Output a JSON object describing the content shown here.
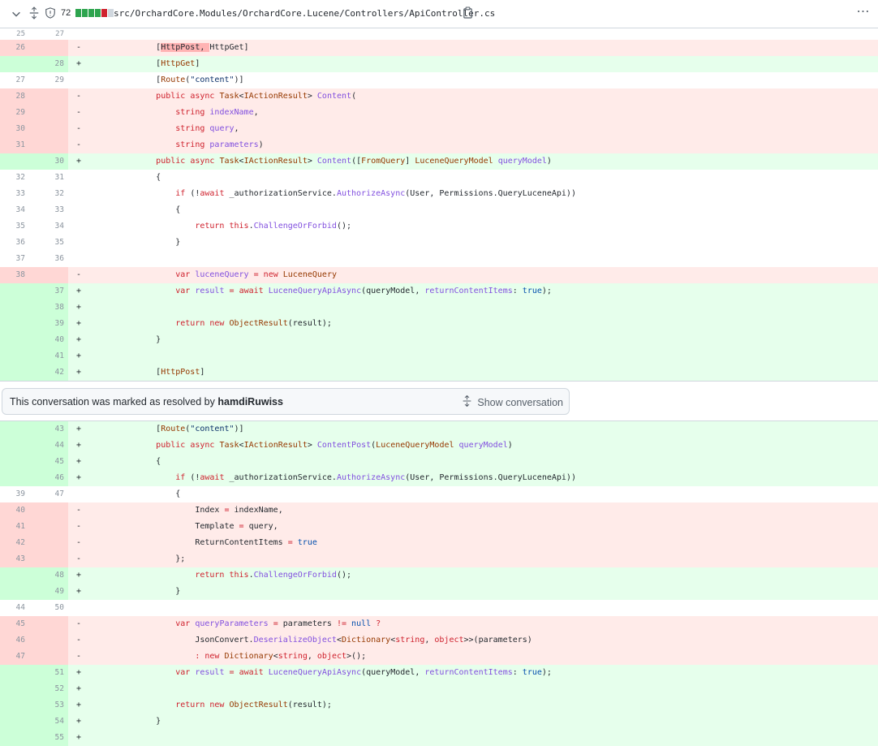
{
  "file": {
    "changed_count": "72",
    "path": "src/OrchardCore.Modules/OrchardCore.Lucene/Controllers/ApiController.cs",
    "diffstat_colors": [
      "#2da44e",
      "#2da44e",
      "#2da44e",
      "#2da44e",
      "#cf222e",
      "#d0d7de"
    ],
    "more_icon": "kebab-horizontal-icon"
  },
  "conversation": {
    "text": "This conversation was marked as resolved by ",
    "user": "hamdiRuwiss",
    "show_label": "Show conversation"
  },
  "hunk_top": {
    "left": "25",
    "right": "27"
  },
  "rows_a": [
    {
      "t": "del",
      "l": "26",
      "r": "",
      "s": "-",
      "html": "        [<span class=\"hl\">HttpPost, </span>HttpGet]"
    },
    {
      "t": "add",
      "l": "",
      "r": "28",
      "s": "+",
      "html": "        [<span class=\"ty\">HttpGet</span>]"
    },
    {
      "t": "ctx",
      "l": "27",
      "r": "29",
      "s": "",
      "html": "        [<span class=\"ty\">Route</span>(<span class=\"st\">\"content\"</span>)]"
    },
    {
      "t": "del",
      "l": "28",
      "r": "",
      "s": "-",
      "html": "        <span class=\"kw\">public async</span> <span class=\"ty\">Task</span>&lt;<span class=\"ty\">IActionResult</span>&gt; <span class=\"fn\">Content</span>("
    },
    {
      "t": "del",
      "l": "29",
      "r": "",
      "s": "-",
      "html": "            <span class=\"kw\">string</span> <span class=\"fn\">indexName</span>,"
    },
    {
      "t": "del",
      "l": "30",
      "r": "",
      "s": "-",
      "html": "            <span class=\"kw\">string</span> <span class=\"fn\">query</span>,"
    },
    {
      "t": "del",
      "l": "31",
      "r": "",
      "s": "-",
      "html": "            <span class=\"kw\">string</span> <span class=\"fn\">parameters</span>)"
    },
    {
      "t": "add",
      "l": "",
      "r": "30",
      "s": "+",
      "html": "        <span class=\"kw\">public async</span> <span class=\"ty\">Task</span>&lt;<span class=\"ty\">IActionResult</span>&gt; <span class=\"fn\">Content</span>([<span class=\"ty\">FromQuery</span>] <span class=\"ty\">LuceneQueryModel</span> <span class=\"fn\">queryModel</span>)"
    },
    {
      "t": "ctx",
      "l": "32",
      "r": "31",
      "s": "",
      "html": "        {"
    },
    {
      "t": "ctx",
      "l": "33",
      "r": "32",
      "s": "",
      "html": "            <span class=\"kw\">if</span> (!<span class=\"kw\">await</span> _authorizationService.<span class=\"fn\">AuthorizeAsync</span>(User, Permissions.QueryLuceneApi))"
    },
    {
      "t": "ctx",
      "l": "34",
      "r": "33",
      "s": "",
      "html": "            {"
    },
    {
      "t": "ctx",
      "l": "35",
      "r": "34",
      "s": "",
      "html": "                <span class=\"kw\">return this</span>.<span class=\"fn\">ChallengeOrForbid</span>();"
    },
    {
      "t": "ctx",
      "l": "36",
      "r": "35",
      "s": "",
      "html": "            }"
    },
    {
      "t": "ctx",
      "l": "37",
      "r": "36",
      "s": "",
      "html": ""
    },
    {
      "t": "del",
      "l": "38",
      "r": "",
      "s": "-",
      "html": "            <span class=\"kw\">var</span> <span class=\"fn\">luceneQuery</span> <span class=\"kw\">=</span> <span class=\"kw\">new</span> <span class=\"ty\">LuceneQuery</span>"
    },
    {
      "t": "add",
      "l": "",
      "r": "37",
      "s": "+",
      "html": "            <span class=\"kw\">var</span> <span class=\"fn\">result</span> <span class=\"kw\">=</span> <span class=\"kw\">await</span> <span class=\"fn\">LuceneQueryApiAsync</span>(queryModel, <span class=\"fn\">returnContentItems</span>: <span class=\"nm\">true</span>);"
    },
    {
      "t": "add",
      "l": "",
      "r": "38",
      "s": "+",
      "html": ""
    },
    {
      "t": "add",
      "l": "",
      "r": "39",
      "s": "+",
      "html": "            <span class=\"kw\">return new</span> <span class=\"ty\">ObjectResult</span>(result);"
    },
    {
      "t": "add",
      "l": "",
      "r": "40",
      "s": "+",
      "html": "        }"
    },
    {
      "t": "add",
      "l": "",
      "r": "41",
      "s": "+",
      "html": ""
    },
    {
      "t": "add",
      "l": "",
      "r": "42",
      "s": "+",
      "html": "        [<span class=\"ty\">HttpPost</span>]"
    }
  ],
  "rows_b": [
    {
      "t": "add",
      "l": "",
      "r": "43",
      "s": "+",
      "html": "        [<span class=\"ty\">Route</span>(<span class=\"st\">\"content\"</span>)]"
    },
    {
      "t": "add",
      "l": "",
      "r": "44",
      "s": "+",
      "html": "        <span class=\"kw\">public async</span> <span class=\"ty\">Task</span>&lt;<span class=\"ty\">IActionResult</span>&gt; <span class=\"fn\">ContentPost</span>(<span class=\"ty\">LuceneQueryModel</span> <span class=\"fn\">queryModel</span>)"
    },
    {
      "t": "add",
      "l": "",
      "r": "45",
      "s": "+",
      "html": "        {"
    },
    {
      "t": "add",
      "l": "",
      "r": "46",
      "s": "+",
      "html": "            <span class=\"kw\">if</span> (!<span class=\"kw\">await</span> _authorizationService.<span class=\"fn\">AuthorizeAsync</span>(User, Permissions.QueryLuceneApi))"
    },
    {
      "t": "ctx",
      "l": "39",
      "r": "47",
      "s": "",
      "html": "            {"
    },
    {
      "t": "del",
      "l": "40",
      "r": "",
      "s": "-",
      "html": "                Index <span class=\"kw\">=</span> indexName,"
    },
    {
      "t": "del",
      "l": "41",
      "r": "",
      "s": "-",
      "html": "                Template <span class=\"kw\">=</span> query,"
    },
    {
      "t": "del",
      "l": "42",
      "r": "",
      "s": "-",
      "html": "                ReturnContentItems <span class=\"kw\">=</span> <span class=\"nm\">true</span>"
    },
    {
      "t": "del",
      "l": "43",
      "r": "",
      "s": "-",
      "html": "            };"
    },
    {
      "t": "add",
      "l": "",
      "r": "48",
      "s": "+",
      "html": "                <span class=\"kw\">return this</span>.<span class=\"fn\">ChallengeOrForbid</span>();"
    },
    {
      "t": "add",
      "l": "",
      "r": "49",
      "s": "+",
      "html": "            }"
    },
    {
      "t": "ctx",
      "l": "44",
      "r": "50",
      "s": "",
      "html": ""
    },
    {
      "t": "del",
      "l": "45",
      "r": "",
      "s": "-",
      "html": "            <span class=\"kw\">var</span> <span class=\"fn\">queryParameters</span> <span class=\"kw\">=</span> parameters <span class=\"kw\">!=</span> <span class=\"nm\">null</span> <span class=\"kw\">?</span>"
    },
    {
      "t": "del",
      "l": "46",
      "r": "",
      "s": "-",
      "html": "                JsonConvert.<span class=\"fn\">DeserializeObject</span>&lt;<span class=\"ty\">Dictionary</span>&lt;<span class=\"kw\">string</span>, <span class=\"kw\">object</span>&gt;&gt;(parameters)"
    },
    {
      "t": "del",
      "l": "47",
      "r": "",
      "s": "-",
      "html": "                <span class=\"kw\">:</span> <span class=\"kw\">new</span> <span class=\"ty\">Dictionary</span>&lt;<span class=\"kw\">string</span>, <span class=\"kw\">object</span>&gt;();"
    },
    {
      "t": "add",
      "l": "",
      "r": "51",
      "s": "+",
      "html": "            <span class=\"kw\">var</span> <span class=\"fn\">result</span> <span class=\"kw\">=</span> <span class=\"kw\">await</span> <span class=\"fn\">LuceneQueryApiAsync</span>(queryModel, <span class=\"fn\">returnContentItems</span>: <span class=\"nm\">true</span>);"
    },
    {
      "t": "add",
      "l": "",
      "r": "52",
      "s": "+",
      "html": ""
    },
    {
      "t": "add",
      "l": "",
      "r": "53",
      "s": "+",
      "html": "            <span class=\"kw\">return new</span> <span class=\"ty\">ObjectResult</span>(result);"
    },
    {
      "t": "add",
      "l": "",
      "r": "54",
      "s": "+",
      "html": "        }"
    },
    {
      "t": "add",
      "l": "",
      "r": "55",
      "s": "+",
      "html": ""
    }
  ]
}
